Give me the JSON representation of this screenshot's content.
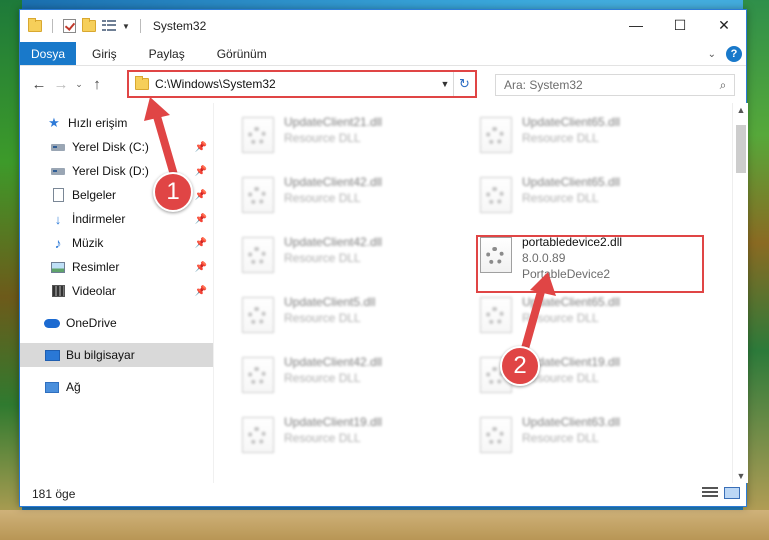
{
  "window": {
    "title": "System32",
    "controls": {
      "minimize": "—",
      "maximize": "☐",
      "close": "✕"
    }
  },
  "ribbon": {
    "file_tab": "Dosya",
    "tabs": [
      "Giriş",
      "Paylaş",
      "Görünüm"
    ]
  },
  "navigation": {
    "back": "←",
    "forward": "→",
    "recent": "⌄",
    "up": "↑",
    "address": "C:\\Windows\\System32",
    "search_placeholder": "Ara: System32"
  },
  "sidebar": {
    "quick_access": "Hızlı erişim",
    "items": [
      {
        "label": "Yerel Disk (C:)",
        "icon": "drive-icon"
      },
      {
        "label": "Yerel Disk (D:)",
        "icon": "drive-icon"
      },
      {
        "label": "Belgeler",
        "icon": "documents-icon"
      },
      {
        "label": "İndirmeler",
        "icon": "download-icon"
      },
      {
        "label": "Müzik",
        "icon": "music-icon"
      },
      {
        "label": "Resimler",
        "icon": "pictures-icon"
      },
      {
        "label": "Videolar",
        "icon": "videos-icon"
      }
    ],
    "onedrive": "OneDrive",
    "this_pc": "Bu bilgisayar",
    "network": "Ağ"
  },
  "files": [
    {
      "name": "UpdateClient21.dll",
      "sub": "Resource DLL"
    },
    {
      "name": "UpdateClient65.dll",
      "sub": "Resource DLL"
    },
    {
      "name": "UpdateClient42.dll",
      "sub": "Resource DLL"
    },
    {
      "name": "UpdateClient65.dll",
      "sub": "Resource DLL"
    },
    {
      "name": "UpdateClient42.dll",
      "sub": "Resource DLL"
    },
    {
      "name": "portabledevice2.dll",
      "sub": "8.0.0.89",
      "sub2": "PortableDevice2"
    },
    {
      "name": "UpdateClient5.dll",
      "sub": "Resource DLL"
    },
    {
      "name": "UpdateClient65.dll",
      "sub": "Resource DLL"
    },
    {
      "name": "UpdateClient42.dll",
      "sub": "Resource DLL"
    },
    {
      "name": "UpdateClient19.dll",
      "sub": "Resource DLL"
    },
    {
      "name": "UpdateClient19.dll",
      "sub": "Resource DLL"
    },
    {
      "name": "UpdateClient63.dll",
      "sub": "Resource DLL"
    }
  ],
  "status": {
    "count": "181 öge"
  },
  "annotations": {
    "step1": "1",
    "step2": "2"
  },
  "colors": {
    "accent": "#1979ca",
    "annotation": "#e04545"
  }
}
